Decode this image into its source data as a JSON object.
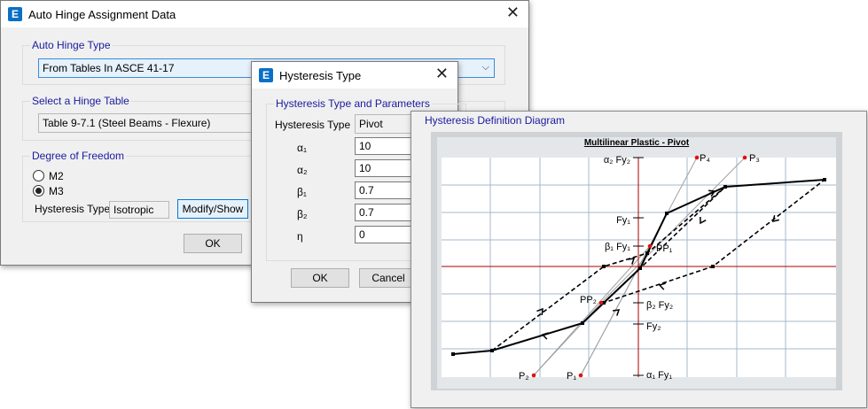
{
  "hinge_window": {
    "title": "Auto Hinge Assignment Data",
    "auto_hinge_type": {
      "group_label": "Auto Hinge Type",
      "selected": "From Tables In ASCE 41-17"
    },
    "hinge_table": {
      "group_label": "Select a Hinge Table",
      "selected": "Table 9-7.1 (Steel Beams - Flexure)"
    },
    "dof": {
      "group_label": "Degree of Freedom",
      "options": [
        {
          "label": "M2",
          "selected": false
        },
        {
          "label": "M3",
          "selected": true
        }
      ],
      "hysteresis_label": "Hysteresis Type",
      "hysteresis_value": "Isotropic",
      "modify_button": "Modify/Show"
    },
    "ok_button": "OK"
  },
  "hysteresis_window": {
    "title": "Hysteresis Type",
    "group_label": "Hysteresis Type and Parameters",
    "type_label": "Hysteresis Type",
    "type_value": "Pivot",
    "params": [
      {
        "label": "α₁",
        "value": "10"
      },
      {
        "label": "α₂",
        "value": "10"
      },
      {
        "label": "β₁",
        "value": "0.7"
      },
      {
        "label": "β₂",
        "value": "0.7"
      },
      {
        "label": "η",
        "value": "0"
      }
    ],
    "ok_button": "OK",
    "cancel_button": "Cancel"
  },
  "diagram_window": {
    "group_label": "Hysteresis Definition Diagram",
    "plot_title": "Multilinear Plastic - Pivot",
    "labels": {
      "a2fy2": "α₂ Fy₂",
      "fy1": "Fy₁",
      "b1fy1": "β₁ Fy₁",
      "b2fy2": "β₂ Fy₂",
      "fy2": "Fy₂",
      "a1fy1": "α₁ Fy₁",
      "p1": "P₁",
      "p2": "P₂",
      "p3": "P₃",
      "p4": "P₄",
      "pp1": "PP₁",
      "pp2": "PP₂"
    },
    "colors": {
      "axis": "#aa0000",
      "pivot_point": "#e01010",
      "grid": "#a6b8cc",
      "curve": "#000000",
      "guide": "#a0a0a0"
    }
  }
}
